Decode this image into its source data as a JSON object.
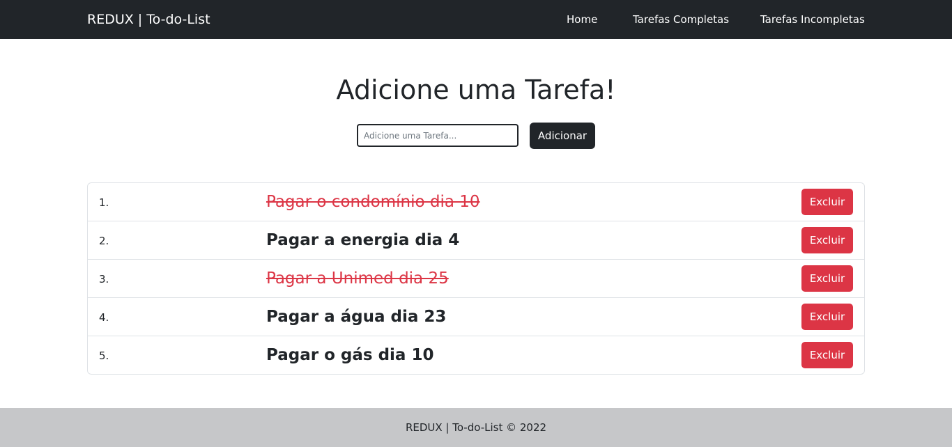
{
  "navbar": {
    "brand": "REDUX | To-do-List",
    "links": [
      {
        "label": "Home"
      },
      {
        "label": "Tarefas Completas"
      },
      {
        "label": "Tarefas Incompletas"
      }
    ]
  },
  "main": {
    "title": "Adicione uma Tarefa!",
    "input": {
      "placeholder": "Adicione uma Tarefa...",
      "value": ""
    },
    "add_label": "Adicionar"
  },
  "tasks": [
    {
      "number": "1.",
      "text": "Pagar o condomínio dia 10",
      "completed": true,
      "delete_label": "Excluir"
    },
    {
      "number": "2.",
      "text": "Pagar a energia dia 4",
      "completed": false,
      "delete_label": "Excluir"
    },
    {
      "number": "3.",
      "text": "Pagar a Unimed dia 25",
      "completed": true,
      "delete_label": "Excluir"
    },
    {
      "number": "4.",
      "text": "Pagar a água dia 23",
      "completed": false,
      "delete_label": "Excluir"
    },
    {
      "number": "5.",
      "text": "Pagar o gás dia 10",
      "completed": false,
      "delete_label": "Excluir"
    }
  ],
  "footer": {
    "text": "REDUX | To-do-List © 2022"
  },
  "colors": {
    "navbar_bg": "#212529",
    "completed_task": "#dc3545",
    "delete_button": "#dc3545",
    "footer_bg": "#c6c7c9"
  }
}
